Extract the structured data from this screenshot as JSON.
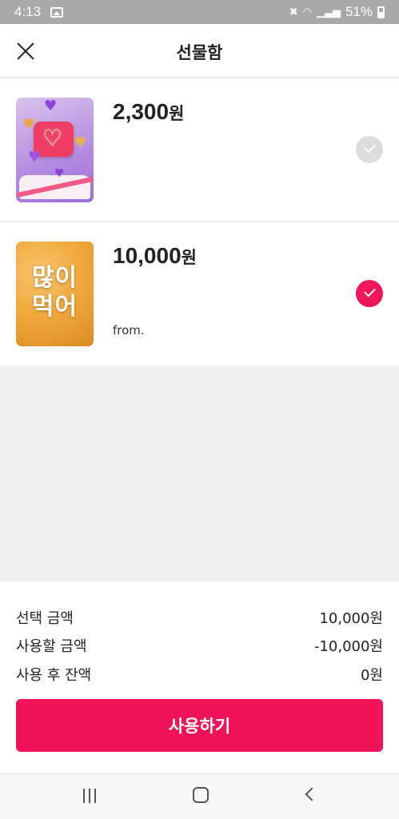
{
  "status_bar": {
    "time": "4:13",
    "battery_percent": "51%",
    "icons": [
      "image-icon",
      "mute-vibrate-icon",
      "volte-icon",
      "wifi-icon",
      "signal-icon",
      "battery-icon"
    ]
  },
  "header": {
    "title": "선물함",
    "close_icon": "close-icon"
  },
  "gifts": [
    {
      "amount": "2,300",
      "unit": "원",
      "from": "",
      "selected": false,
      "image": "hearts-gift-image"
    },
    {
      "amount": "10,000",
      "unit": "원",
      "from": "from.",
      "selected": true,
      "image": "food-image",
      "image_text_line1": "많이",
      "image_text_line2": "먹어"
    }
  ],
  "summary": {
    "selected_label": "선택 금액",
    "selected_value": "10,000원",
    "use_label": "사용할 금액",
    "use_value": "-10,000원",
    "remaining_label": "사용 후 잔액",
    "remaining_value": "0원",
    "button_label": "사용하기"
  },
  "colors": {
    "accent": "#f0135a",
    "check_unselected": "#dcdcdc",
    "background": "#efefef"
  }
}
